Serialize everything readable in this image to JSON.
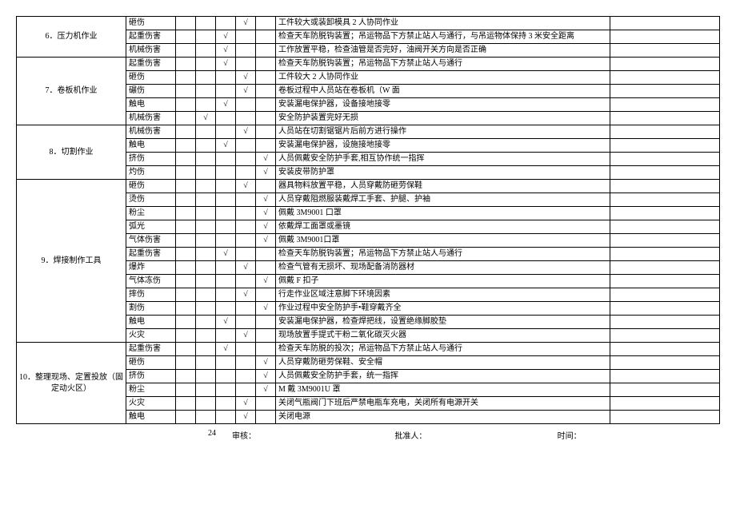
{
  "footer": {
    "page_num": "24",
    "reviewer_label": "审核：",
    "approver_label": "批准人：",
    "time_label": "时间："
  },
  "rows": [
    {
      "op": "",
      "haz": "砸伤",
      "checks": [
        "",
        "",
        "",
        "√",
        ""
      ],
      "desc": "工件较大或装卸模具 2 人协同作业",
      "tail": ""
    },
    {
      "op": "6．压力机作业",
      "haz": "起重伤害",
      "checks": [
        "",
        "",
        "√",
        "",
        ""
      ],
      "desc": "检查天车防脱钩装置；吊运物品下方禁止站人与通行，与吊运物体保持 3 米安全距离",
      "tail": ""
    },
    {
      "op": "",
      "haz": "机械伤害",
      "checks": [
        "",
        "",
        "√",
        "",
        ""
      ],
      "desc": "工作放置平稳，检查油管是否完好，油阀开关方向是否正确",
      "tail": ""
    },
    {
      "op": "",
      "haz": "起重伤害",
      "checks": [
        "",
        "",
        "√",
        "",
        ""
      ],
      "desc": "检查天车防脱钩装置；吊运物品下方禁止站人与通行",
      "tail": ""
    },
    {
      "op": "",
      "haz": "砸伤",
      "checks": [
        "",
        "",
        "",
        "√",
        ""
      ],
      "desc": "工件较大 2 人协同作业",
      "tail": ""
    },
    {
      "op": "7．卷板机作业",
      "haz": "碾伤",
      "checks": [
        "",
        "",
        "",
        "√",
        ""
      ],
      "desc": "卷板过程中人员站在卷板机（W 面",
      "tail": ""
    },
    {
      "op": "",
      "haz": "触电",
      "checks": [
        "",
        "",
        "√",
        "",
        ""
      ],
      "desc": "安装漏电保护器，设备接地接零",
      "tail": ""
    },
    {
      "op": "",
      "haz": "机械伤害",
      "checks": [
        "",
        "√",
        "",
        "",
        ""
      ],
      "desc": "安全防护装置完好无损",
      "tail": ""
    },
    {
      "op": "",
      "haz": "机械伤害",
      "checks": [
        "",
        "",
        "",
        "√",
        ""
      ],
      "desc": "人员站在切割锯锯片后前方进行操作",
      "tail": ""
    },
    {
      "op": "8．切割作业",
      "haz": "触电",
      "checks": [
        "",
        "",
        "√",
        "",
        ""
      ],
      "desc": "安装漏电保护器，设施接地接零",
      "tail": ""
    },
    {
      "op": "",
      "haz": "挤伤",
      "checks": [
        "",
        "",
        "",
        "",
        "√"
      ],
      "desc": "人员佩戴安全防护手套,相互协作统一指挥",
      "tail": ""
    },
    {
      "op": "",
      "haz": "灼伤",
      "checks": [
        "",
        "",
        "",
        "",
        "√"
      ],
      "desc": "安装皮带防护罩",
      "tail": ""
    },
    {
      "op": "",
      "haz": "砸伤",
      "checks": [
        "",
        "",
        "",
        "√",
        ""
      ],
      "desc": "器具物料放置平稳，人员穿戴防砸劳保鞋",
      "tail": ""
    },
    {
      "op": "",
      "haz": "烫伤",
      "checks": [
        "",
        "",
        "",
        "",
        "√"
      ],
      "desc": "人员穿戴阻燃服装戴焊工手套、护腿、护袖",
      "tail": ""
    },
    {
      "op": "",
      "haz": "粉尘",
      "checks": [
        "",
        "",
        "",
        "",
        "√"
      ],
      "desc": "佩戴 3M9001 口罩",
      "tail": ""
    },
    {
      "op": "",
      "haz": "弧光",
      "checks": [
        "",
        "",
        "",
        "",
        "√"
      ],
      "desc": "依戴焊工面罩或墨镜",
      "tail": ""
    },
    {
      "op": "",
      "haz": "气体伤害",
      "checks": [
        "",
        "",
        "",
        "",
        "√"
      ],
      "desc": "佩戴 3M9001口罩",
      "tail": ""
    },
    {
      "op": "9．焊接制作工具",
      "haz": "起重伤害",
      "checks": [
        "",
        "",
        "√",
        "",
        ""
      ],
      "desc": "检查天车防脱钩装置；吊运物品下方禁止站人与通行",
      "tail": ""
    },
    {
      "op": "",
      "haz": "爆炸",
      "checks": [
        "",
        "",
        "",
        "√",
        ""
      ],
      "desc": "检查气管有无损坏、现场配备消防器材",
      "tail": ""
    },
    {
      "op": "",
      "haz": "气体冻伤",
      "checks": [
        "",
        "",
        "",
        "",
        "√"
      ],
      "desc": "佩戴 F 扣子",
      "tail": ""
    },
    {
      "op": "",
      "haz": "摔伤",
      "checks": [
        "",
        "",
        "",
        "√",
        ""
      ],
      "desc": "行走作业区域注意脚下环境因素",
      "tail": ""
    },
    {
      "op": "",
      "haz": "割伤",
      "checks": [
        "",
        "",
        "",
        "",
        "√"
      ],
      "desc": "作业过程中安全防护手•鞋穿戴齐全",
      "tail": ""
    },
    {
      "op": "",
      "haz": "触电",
      "checks": [
        "",
        "",
        "√",
        "",
        ""
      ],
      "desc": "安装漏电保护器，检查焊把线，设置绝缘脚胶垫",
      "tail": ""
    },
    {
      "op": "",
      "haz": "火灾",
      "checks": [
        "",
        "",
        "",
        "√",
        ""
      ],
      "desc": "现场放置手提式干粉二氧化碳灭火器",
      "tail": ""
    },
    {
      "op": "",
      "haz": "起重伤害",
      "checks": [
        "",
        "",
        "√",
        "",
        ""
      ],
      "desc": "检查天车防脱的投次；吊运物品下方禁止站人与通行",
      "tail": ""
    },
    {
      "op": "",
      "haz": "砸伤",
      "checks": [
        "",
        "",
        "",
        "",
        "√"
      ],
      "desc": "人员穿戴防砸劳保鞋、安全帽",
      "tail": ""
    },
    {
      "op": "10．整理现场、定置投放（固定动火区）",
      "haz": "挤伤",
      "checks": [
        "",
        "",
        "",
        "",
        "√"
      ],
      "desc": "人员佩戴安全防护手套，统一指挥",
      "tail": ""
    },
    {
      "op": "",
      "haz": "粉尘",
      "checks": [
        "",
        "",
        "",
        "",
        "√"
      ],
      "desc": "M 戴 3M9001U 罩",
      "tail": ""
    },
    {
      "op": "",
      "haz": "火灾",
      "checks": [
        "",
        "",
        "",
        "√",
        ""
      ],
      "desc": "关闭气瓶阀门下班后严禁电瓶车充电，关闭所有电源开关",
      "tail": ""
    },
    {
      "op": "",
      "haz": "触电",
      "checks": [
        "",
        "",
        "",
        "√",
        ""
      ],
      "desc": "关闭电源",
      "tail": ""
    }
  ],
  "groups": [
    {
      "start": 0,
      "span": 3,
      "label_row": 1
    },
    {
      "start": 3,
      "span": 5,
      "label_row": 5
    },
    {
      "start": 8,
      "span": 4,
      "label_row": 9
    },
    {
      "start": 12,
      "span": 12,
      "label_row": 17
    },
    {
      "start": 24,
      "span": 6,
      "label_row": 26
    }
  ]
}
